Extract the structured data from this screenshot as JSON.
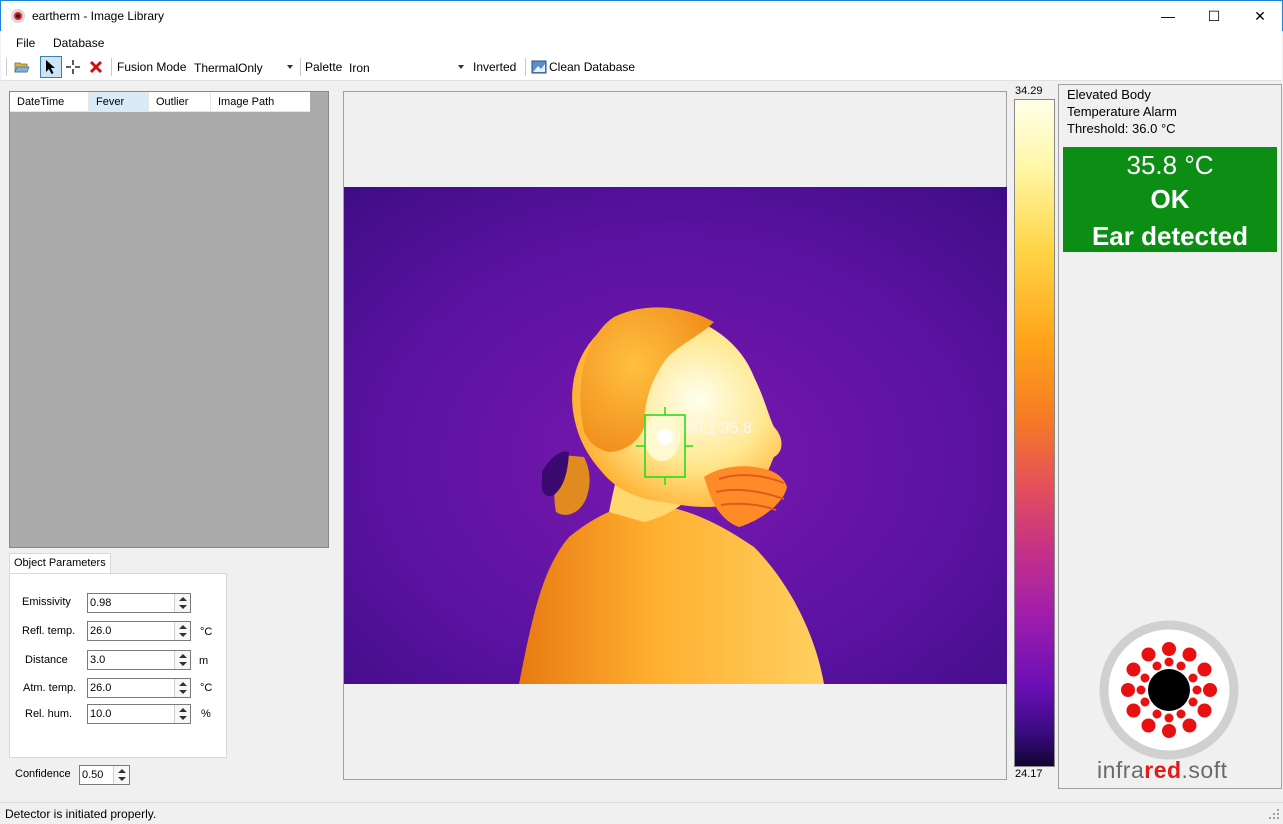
{
  "window": {
    "app_name": "eartherm",
    "title_separator": "-",
    "subtitle": "Image Library",
    "title": "eartherm - Image Library",
    "min_glyph": "—",
    "max_glyph": "☐",
    "close_glyph": "✕"
  },
  "menu": [
    "File",
    "Database"
  ],
  "toolbar": {
    "fusion_mode_label": "Fusion Mode",
    "fusion_mode_value": "ThermalOnly",
    "palette_label": "Palette",
    "palette_value": "Iron",
    "inverted_label": "Inverted",
    "clean_db_label": "Clean Database",
    "icons": [
      "open-folder-icon",
      "pointer-icon",
      "crosshair-icon",
      "delete-icon",
      "database-clean-icon"
    ]
  },
  "list": {
    "columns": [
      "DateTime",
      "Fever",
      "Outlier",
      "Image Path"
    ],
    "selected_column": "Fever",
    "rows": []
  },
  "object_params": {
    "tab_label": "Object Parameters",
    "emissivity": {
      "label": "Emissivity",
      "value": "0.98",
      "unit": ""
    },
    "refl_temp": {
      "label": "Refl. temp.",
      "value": "26.0",
      "unit": "°C"
    },
    "distance": {
      "label": "Distance",
      "value": "3.0",
      "unit": "m"
    },
    "atm_temp": {
      "label": "Atm. temp.",
      "value": "26.0",
      "unit": "°C"
    },
    "rel_hum": {
      "label": "Rel. hum.",
      "value": "10.0",
      "unit": "%"
    }
  },
  "confidence": {
    "label": "Confidence",
    "value": "0.50"
  },
  "thermal_view": {
    "overlay_label": "36.1 35.8",
    "palette_colors": [
      "#4a1090",
      "#7a18b0",
      "#e06a10",
      "#ffb030",
      "#ffe890",
      "#fffff0"
    ]
  },
  "colorbar": {
    "max": "34.29",
    "min": "24.17"
  },
  "alarm": {
    "line1": "Elevated Body",
    "line2": "Temperature Alarm",
    "threshold_label": "Threshold:",
    "threshold_value": "36.0",
    "threshold_unit": "°C",
    "measured_temp": "35.8",
    "measured_unit": "°C",
    "status": "OK",
    "detection": "Ear detected",
    "status_color": "#0c8e14"
  },
  "logo": {
    "part1": "infra",
    "part2": "red",
    "part3": ".soft"
  },
  "statusbar": {
    "text": "Detector is initiated properly."
  }
}
